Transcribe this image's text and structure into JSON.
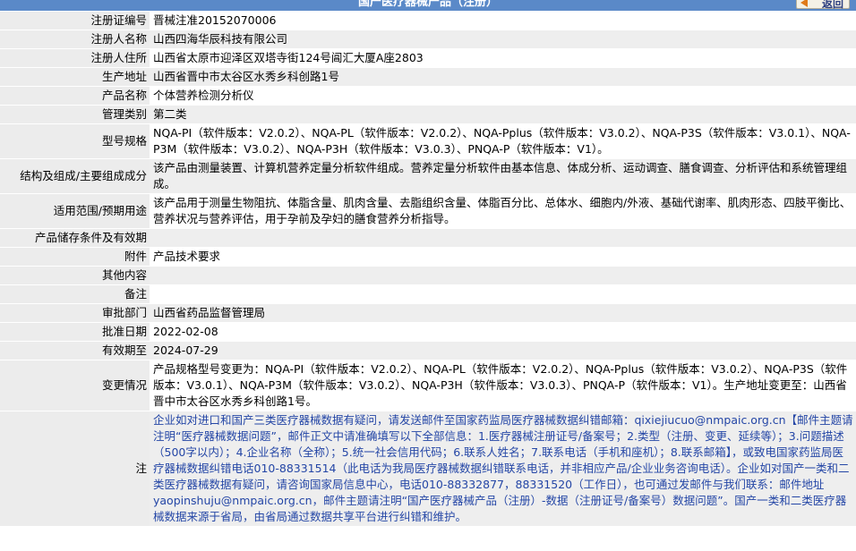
{
  "header": {
    "title": "国产医疗器械产品（注册）",
    "back_label": "返回"
  },
  "rows": [
    {
      "label": "注册证编号",
      "value": "晋械注准20152070006"
    },
    {
      "label": "注册人名称",
      "value": "山西四海华辰科技有限公司"
    },
    {
      "label": "注册人住所",
      "value": "山西省太原市迎泽区双塔寺街124号阊汇大厦A座2803"
    },
    {
      "label": "生产地址",
      "value": "山西省晋中市太谷区水秀乡科创路1号"
    },
    {
      "label": "产品名称",
      "value": "个体营养检测分析仪"
    },
    {
      "label": "管理类别",
      "value": "第二类"
    },
    {
      "label": "型号规格",
      "value": "NQA-PI（软件版本：V2.0.2）、NQA-PL（软件版本：V2.0.2）、NQA-Pplus（软件版本：V3.0.2）、NQA-P3S（软件版本：V3.0.1）、NQA-P3M（软件版本：V3.0.2）、NQA-P3H（软件版本：V3.0.3）、PNQA-P（软件版本：V1）。"
    },
    {
      "label": "结构及组成/主要组成成分",
      "value": "该产品由测量装置、计算机营养定量分析软件组成。营养定量分析软件由基本信息、体成分析、运动调查、膳食调查、分析评估和系统管理组成。"
    },
    {
      "label": "适用范围/预期用途",
      "value": "该产品用于测量生物阻抗、体脂含量、肌肉含量、去脂组织含量、体脂百分比、总体水、细胞内/外液、基础代谢率、肌肉形态、四肢平衡比、营养状况与营养评估，用于孕前及孕妇的膳食营养分析指导。"
    },
    {
      "label": "产品储存条件及有效期",
      "value": ""
    },
    {
      "label": "附件",
      "value": "产品技术要求"
    },
    {
      "label": "其他内容",
      "value": ""
    },
    {
      "label": "备注",
      "value": ""
    },
    {
      "label": "审批部门",
      "value": "山西省药品监督管理局"
    },
    {
      "label": "批准日期",
      "value": "2022-02-08"
    },
    {
      "label": "有效期至",
      "value": "2024-07-29"
    },
    {
      "label": "变更情况",
      "value": "产品规格型号变更为：NQA-PI（软件版本：V2.0.2）、NQA-PL（软件版本：V2.0.2）、NQA-Pplus（软件版本：V3.0.2）、NQA-P3S（软件版本：V3.0.1）、NQA-P3M（软件版本：V3.0.2）、NQA-P3H（软件版本：V3.0.3）、PNQA-P（软件版本：V1）。生产地址变更至：山西省晋中市太谷区水秀乡科创路1号。"
    }
  ],
  "note": {
    "label": "注",
    "text": "企业如对进口和国产三类医疗器械数据有疑问，请发送邮件至国家药监局医疗器械数据纠错邮箱：qixiejiucuo@nmpaic.org.cn【邮件主题请注明“医疗器械数据问题”，邮件正文中请准确填写以下全部信息：1.医疗器械注册证号/备案号；2.类型（注册、变更、延续等）；3.问题描述（500字以内）；4.企业名称（全称）；5.统一社会信用代码；6.联系人姓名；7.联系电话（手机和座机）；8.联系邮箱】，或致电国家药监局医疗器械数据纠错电话010-88331514（此电话为我局医疗器械数据纠错联系电话，并非相应产品/企业业务咨询电话）。企业如对国产一类和二类医疗器械数据有疑问，请咨询国家局信息中心，电话010-88332877，88331520（工作日），也可通过发邮件与我们联系：邮件地址yaopinshuju@nmpaic.org.cn，邮件主题请注明“国产医疗器械产品（注册）-数据（注册证号/备案号）数据问题”。国产一类和二类医疗器械数据来源于省局，由省局通过数据共享平台进行纠错和维护。"
  }
}
